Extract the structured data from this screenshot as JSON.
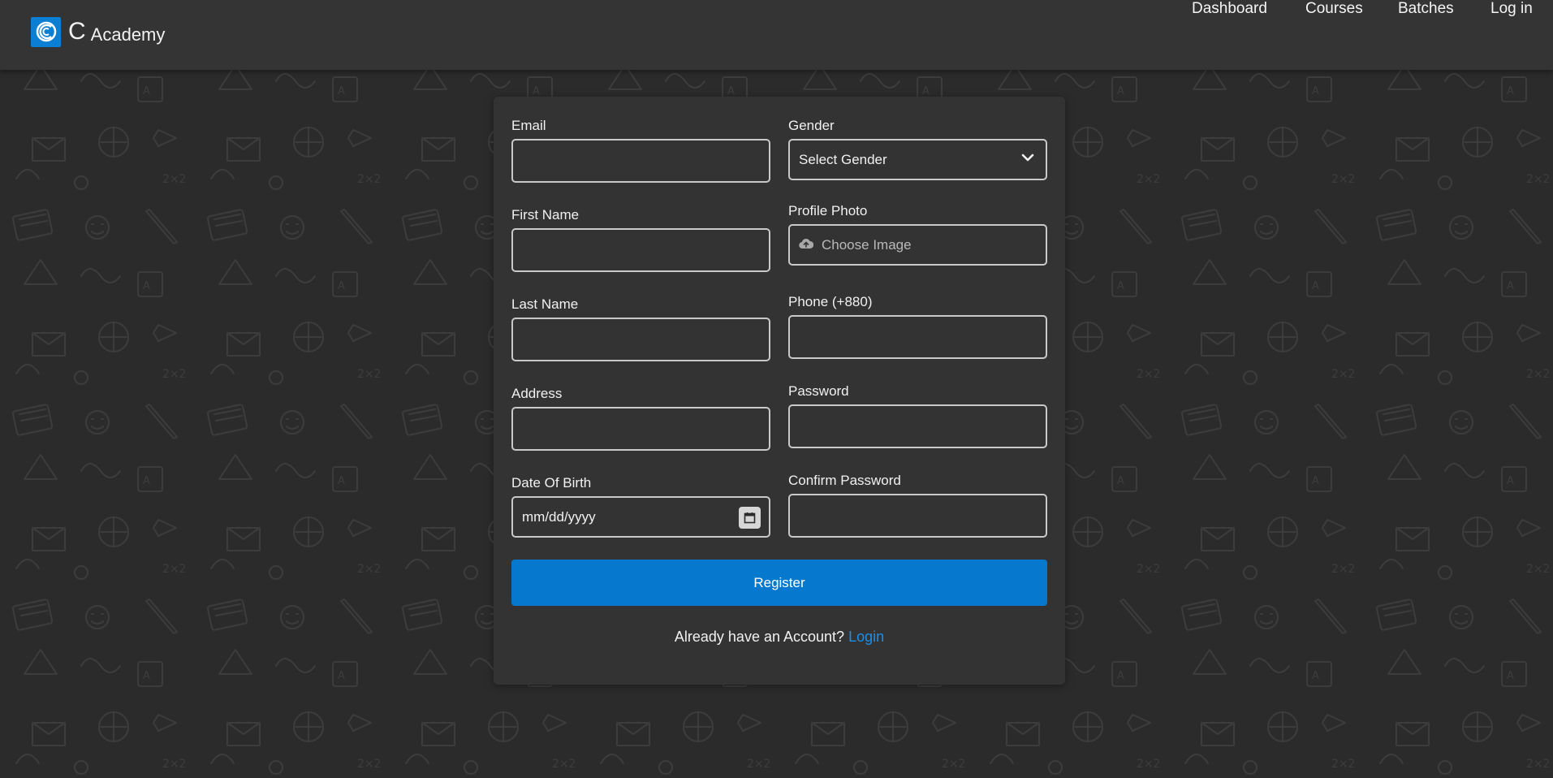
{
  "brand": {
    "letter": "C",
    "name": "Academy"
  },
  "nav": {
    "items": [
      "Dashboard",
      "Courses",
      "Batches",
      "Log in"
    ]
  },
  "form": {
    "email": {
      "label": "Email",
      "value": ""
    },
    "first_name": {
      "label": "First Name",
      "value": ""
    },
    "last_name": {
      "label": "Last Name",
      "value": ""
    },
    "address": {
      "label": "Address",
      "value": ""
    },
    "dob": {
      "label": "Date Of Birth",
      "placeholder": "mm/dd/yyyy"
    },
    "gender": {
      "label": "Gender",
      "selected": "Select Gender"
    },
    "photo": {
      "label": "Profile Photo",
      "button": "Choose Image"
    },
    "phone": {
      "label": "Phone (+880)",
      "value": ""
    },
    "password": {
      "label": "Password",
      "value": ""
    },
    "confirm_password": {
      "label": "Confirm Password",
      "value": ""
    },
    "register_label": "Register",
    "account_prompt": "Already have an Account?",
    "login_link": "Login"
  },
  "colors": {
    "background": "#2b2b2c",
    "navbar": "#343435",
    "card": "#333334",
    "accent": "#0679cf",
    "link": "#1c8ee6"
  },
  "icons": [
    "logo-icon",
    "chevron-down-icon",
    "cloud-upload-icon",
    "calendar-icon"
  ]
}
